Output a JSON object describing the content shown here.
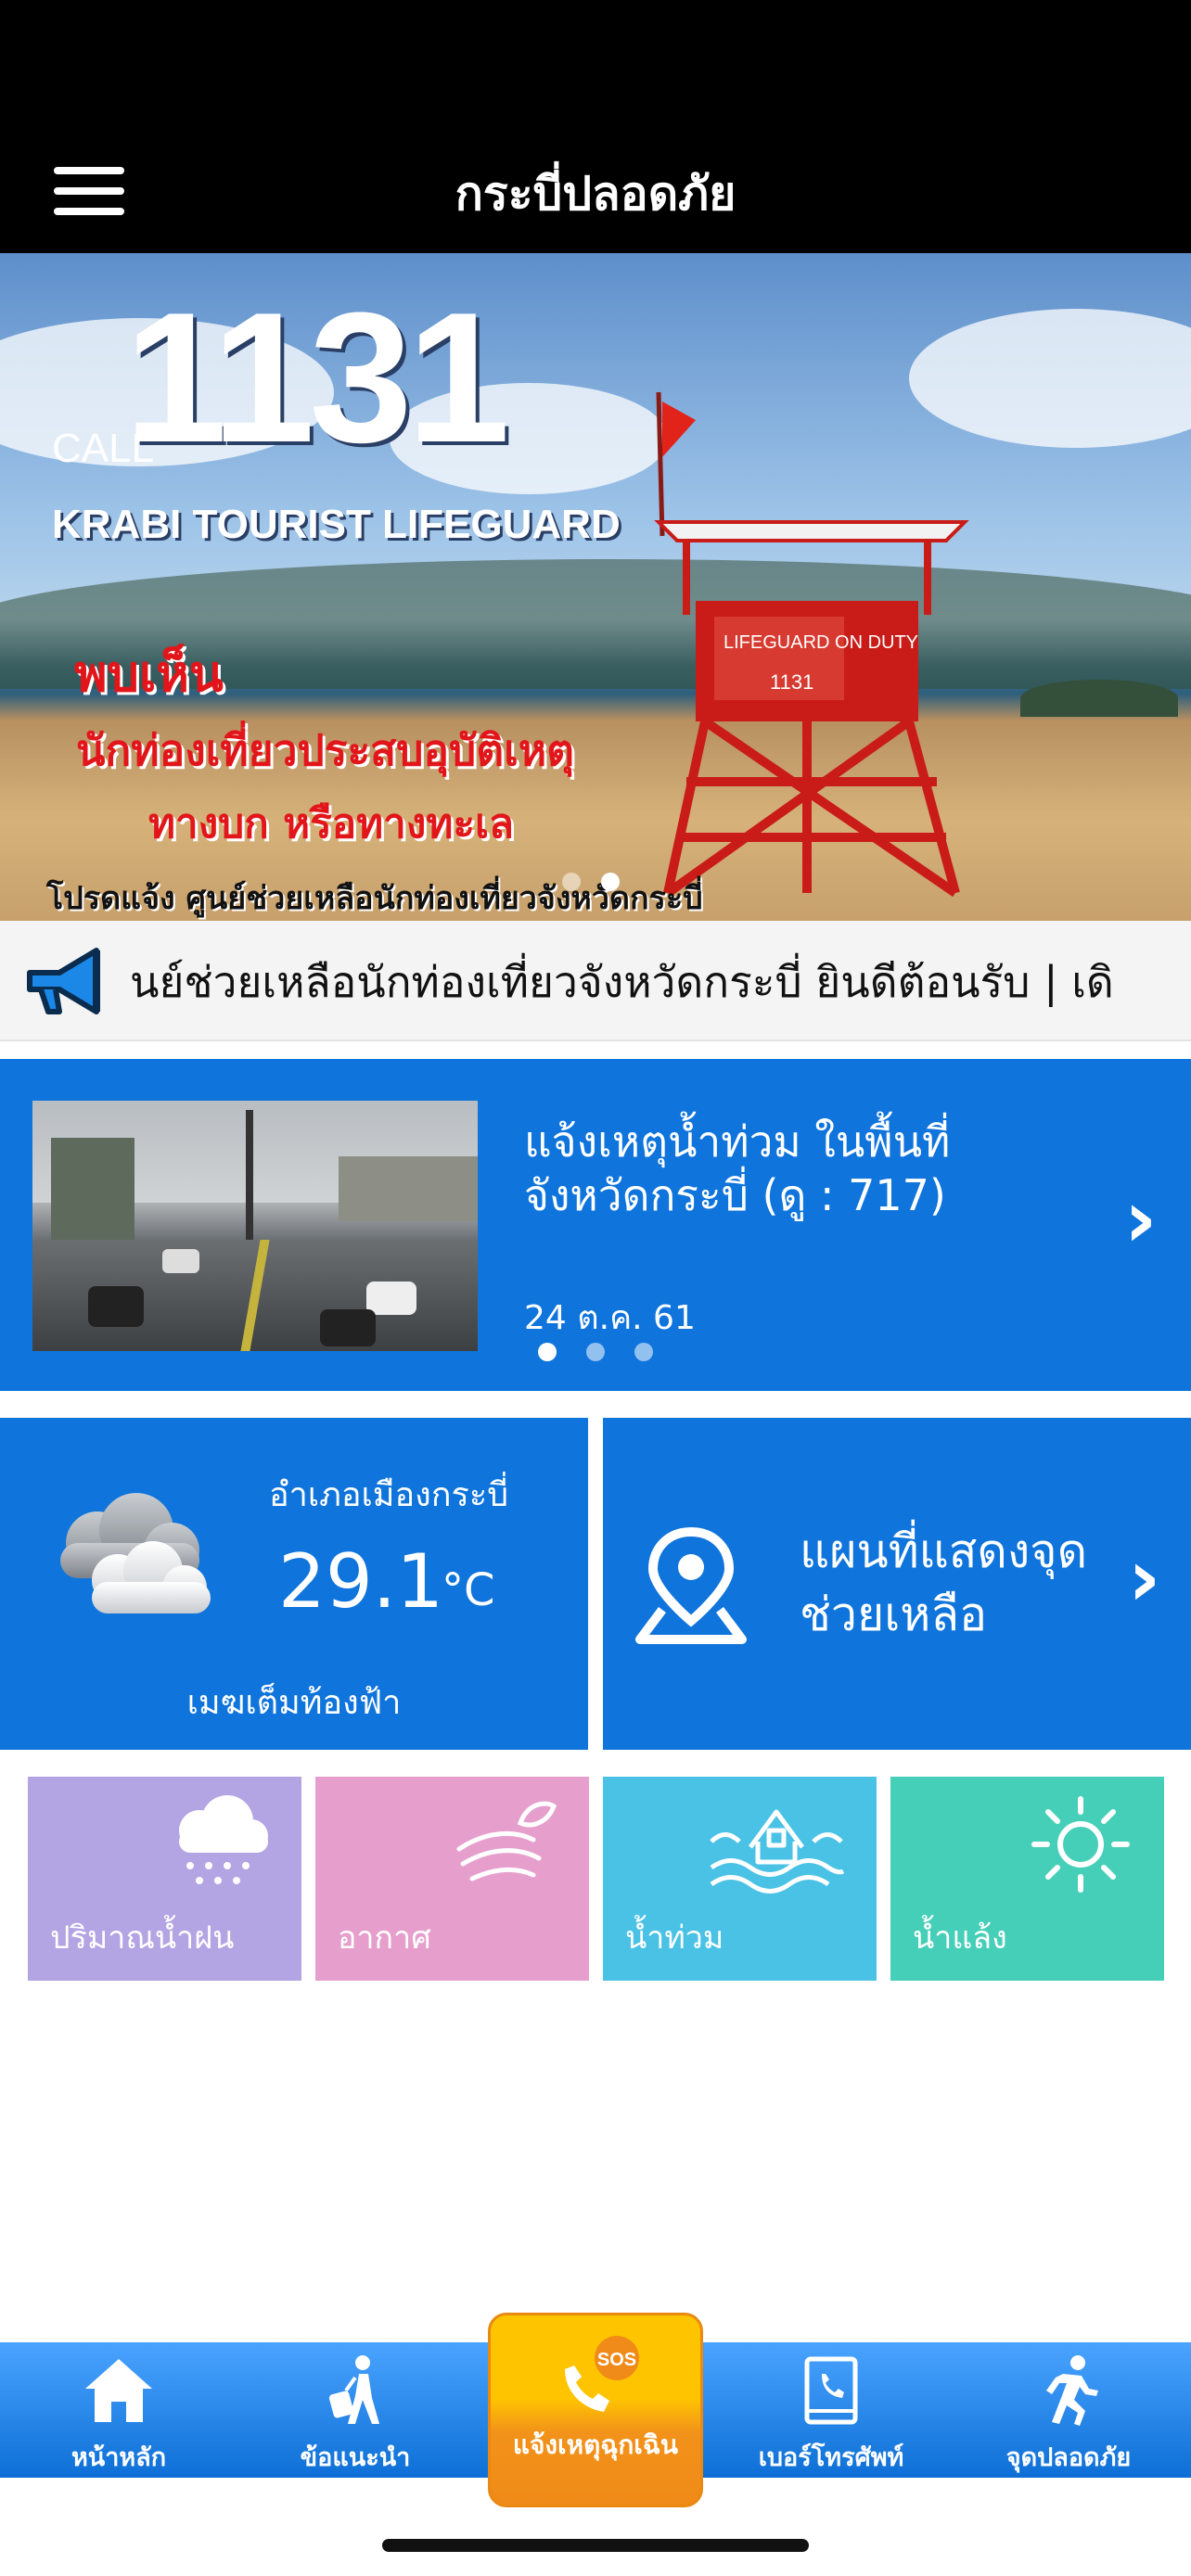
{
  "nav": {
    "title": "กระบี่ปลอดภัย",
    "menu_icon": "hamburger-menu-icon"
  },
  "banner": {
    "call": "CALL",
    "number": "1131",
    "subtitle": "KRABI TOURIST LIFEGUARD",
    "tower_sign_1": "LIFEGUARD ON DUTY",
    "tower_sign_2": "1131",
    "line1": "พบเห็น",
    "line2": "นักท่องเที่ยวประสบอุบัติเหตุ",
    "line3": "ทางบก หรือทางทะเล",
    "line4": "โปรดแจ้ง ศูนย์ช่วยเหลือนักท่องเที่ยวจังหวัดกระบี่",
    "slides": 2,
    "active_slide": 2
  },
  "ticker": {
    "icon": "megaphone-icon",
    "text": "นย์ช่วยเหลือนักท่องเที่ยวจังหวัดกระบี่ ยินดีต้อนรับ | เดิ"
  },
  "news": {
    "title": "แจ้งเหตุน้ำท่วม ในพื้นที่จังหวัดกระบี่ (ดู : 717)",
    "date": "24 ต.ค. 61",
    "slides": 3,
    "active_slide": 1,
    "chevron": "chevron-right-icon"
  },
  "weather": {
    "district": "อำเภอเมืองกระบี่",
    "temperature": "29.1",
    "unit": "°C",
    "description": "เมฆเต็มท้องฟ้า",
    "icon": "cloudy-icon"
  },
  "map_card": {
    "title": "แผนที่แสดงจุดช่วยเหลือ",
    "icon": "map-pin-icon"
  },
  "tiles": [
    {
      "label": "ปริมาณน้ำฝน",
      "icon": "rain-cloud-icon",
      "color": "#b3a4e3"
    },
    {
      "label": "อากาศ",
      "icon": "wind-icon",
      "color": "#e69fcd"
    },
    {
      "label": "น้ำท่วม",
      "icon": "flood-house-icon",
      "color": "#49c2e6"
    },
    {
      "label": "น้ำแล้ง",
      "icon": "sun-icon",
      "color": "#46cfb8"
    }
  ],
  "tabs": [
    {
      "label": "หน้าหลัก",
      "icon": "home-icon"
    },
    {
      "label": "ข้อแนะนำ",
      "icon": "traveler-icon"
    },
    {
      "label": "แจ้งเหตุฉุกเฉิน",
      "icon": "sos-phone-icon",
      "badge": "SOS"
    },
    {
      "label": "เบอร์โทรศัพท์",
      "icon": "phonebook-icon"
    },
    {
      "label": "จุดปลอดภัย",
      "icon": "running-person-icon"
    }
  ],
  "colors": {
    "primary": "#0f74db",
    "sos": "#ffc400",
    "sos_bottom": "#f08a18"
  }
}
